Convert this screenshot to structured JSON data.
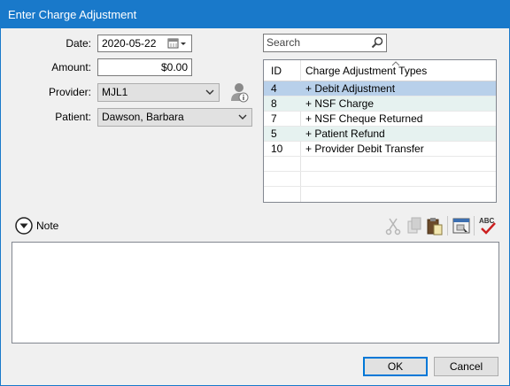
{
  "window": {
    "title": "Enter Charge Adjustment"
  },
  "form": {
    "date_label": "Date:",
    "date_value": "2020-05-22",
    "amount_label": "Amount:",
    "amount_value": "$0.00",
    "provider_label": "Provider:",
    "provider_value": "MJL1",
    "patient_label": "Patient:",
    "patient_value": "Dawson, Barbara"
  },
  "search": {
    "placeholder": "Search"
  },
  "grid": {
    "col_id": "ID",
    "col_name": "Charge Adjustment Types",
    "rows": [
      {
        "id": "4",
        "name": "+ Debit Adjustment"
      },
      {
        "id": "8",
        "name": "+ NSF Charge"
      },
      {
        "id": "7",
        "name": "+ NSF Cheque Returned"
      },
      {
        "id": "5",
        "name": "+ Patient Refund"
      },
      {
        "id": "10",
        "name": "+ Provider Debit Transfer"
      }
    ]
  },
  "note": {
    "label": "Note"
  },
  "buttons": {
    "ok": "OK",
    "cancel": "Cancel"
  },
  "colors": {
    "title_bar": "#1979ca",
    "selected_row": "#b8d0ea",
    "alt_row": "#e6f2f0"
  },
  "icons": [
    "calendar-icon",
    "chevron-down-icon",
    "provider-info-icon",
    "search-icon",
    "cut-icon",
    "copy-icon",
    "paste-icon",
    "insert-template-icon",
    "spell-check-icon"
  ]
}
